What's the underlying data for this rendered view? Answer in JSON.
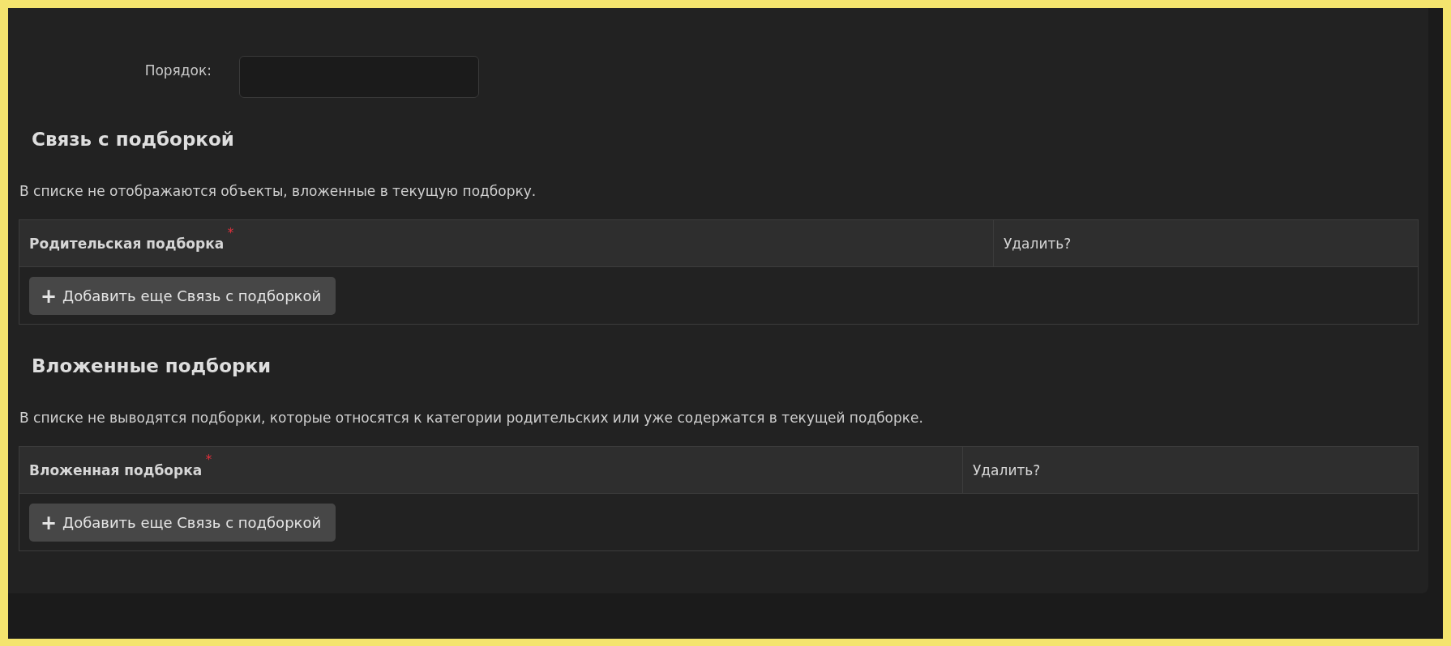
{
  "order_field": {
    "label": "Порядок:"
  },
  "sections": [
    {
      "title": "Связь с подборкой",
      "description": "В списке не отображаются объекты, вложенные в текущую подборку.",
      "columns": [
        {
          "label": "Родительская подборка",
          "required_mark": "*"
        },
        {
          "label": "Удалить?"
        }
      ],
      "add_button": {
        "icon": "+",
        "label": "Добавить еще Связь с подборкой"
      }
    },
    {
      "title": "Вложенные подборки",
      "description": "В списке не выводятся подборки, которые относятся к категории родительских или уже содержатся в текущей подборке.",
      "columns": [
        {
          "label": "Вложенная подборка",
          "required_mark": "*"
        },
        {
          "label": "Удалить?"
        }
      ],
      "add_button": {
        "icon": "+",
        "label": "Добавить еще Связь с подборкой"
      }
    }
  ]
}
